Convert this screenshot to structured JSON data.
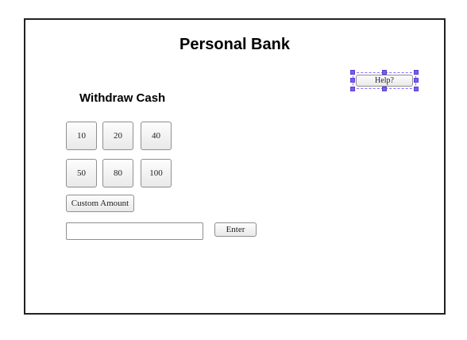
{
  "app": {
    "title": "Personal Bank"
  },
  "withdraw": {
    "heading": "Withdraw Cash",
    "amount_buttons": [
      "10",
      "20",
      "40",
      "50",
      "80",
      "100"
    ],
    "custom_label": "Custom Amount",
    "amount_input": {
      "value": "",
      "placeholder": ""
    },
    "enter_label": "Enter"
  },
  "help": {
    "label": "Help?",
    "selected": true
  },
  "colors": {
    "frame_border": "#222222",
    "selection_handle": "#7b5cf0"
  }
}
